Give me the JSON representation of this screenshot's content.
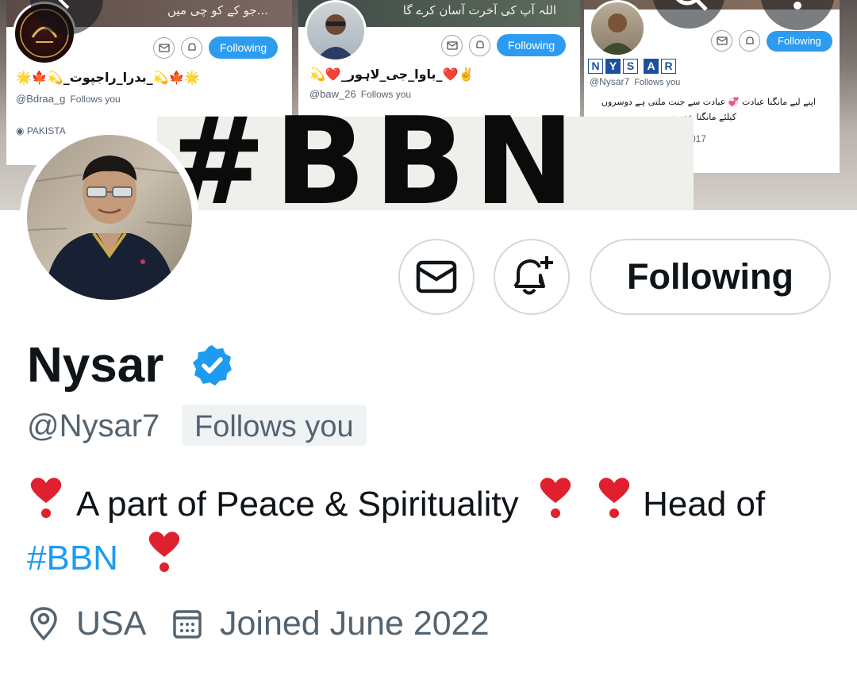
{
  "banner": {
    "hashtag_text": "#BBN",
    "card_left": {
      "cover_text": "...جو کے کو چی میں",
      "name": "🌟🍁💫_بدرا_راجپوت_💫🍁🌟",
      "handle": "@Bdraa_g",
      "follows_you": "Follows you",
      "location": "PAKISTA",
      "follow_label": "Following"
    },
    "card_middle": {
      "cover_text": "اللہ آپ کی آخرت آسان کرے گا",
      "name": "✌️❤️_باوا_جی_لاہور_❤️💫",
      "handle": "@baw_26",
      "follows_you": "Follows you",
      "follow_label": "Following"
    },
    "card_right": {
      "logo_letters": [
        "N",
        "Y",
        "S",
        "A",
        "R"
      ],
      "handle": "@Nysar7",
      "follows_you": "Follows you",
      "bio_line1": "اپنے لیے مانگنا عبادت 💞 عبادت سے جنت ملتی ہے دوسروں",
      "bio_line2": "کیلئے مانگنا خدمت",
      "joined_fragment": "017",
      "follow_label": "Following"
    }
  },
  "actions": {
    "message_icon": "envelope-icon",
    "notify_icon": "bell-plus-icon",
    "follow_label": "Following"
  },
  "profile": {
    "name": "Nysar",
    "verified_icon": "verified-badge-icon",
    "handle": "@Nysar7",
    "follows_you": "Follows you",
    "bio_part1": "A part of Peace & Spirituality",
    "bio_part2": "Head of",
    "bio_hashtag": "#BBN",
    "location": "USA",
    "joined": "Joined June 2022"
  },
  "colors": {
    "accent": "#1d9bf0",
    "secondary_text": "#536471",
    "border": "#cfd9de",
    "heart": "#e0202e"
  }
}
